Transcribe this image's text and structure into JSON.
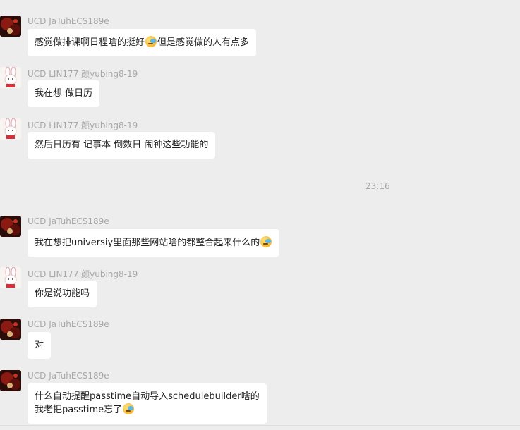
{
  "senders": {
    "a": "UCD JaTuhECS189e",
    "b": "UCD LIN177 颜yubing8-19"
  },
  "messages": [
    {
      "id": 1,
      "sender": "UCD JaTuhECS189e",
      "text_before": "感觉做排课啊日程啥的挺好",
      "text_after": "但是感觉做的人有点多"
    },
    {
      "id": 2,
      "sender": "UCD LIN177 颜yubing8-19",
      "text": "我在想 做日历"
    },
    {
      "id": 3,
      "sender": "UCD LIN177 颜yubing8-19",
      "text": "然后日历有 记事本 倒数日 闹钟这些功能的"
    },
    {
      "id": 4,
      "sender": "UCD JaTuhECS189e",
      "text_before": "我在想把universiy里面那些网站啥的都整合起来什么的",
      "text_after": ""
    },
    {
      "id": 5,
      "sender": "UCD LIN177 颜yubing8-19",
      "text": "你是说功能吗"
    },
    {
      "id": 6,
      "sender": "UCD JaTuhECS189e",
      "text": "对"
    },
    {
      "id": 7,
      "sender": "UCD JaTuhECS189e",
      "line1": "什么自动提醒passtime自动导入schedulebuilder啥的",
      "line2_before": "我老把passtime忘了",
      "line2_after": ""
    }
  ],
  "timestamp": "23:16",
  "icons": {
    "avatar_a": "dark-red-cartoon-avatar",
    "avatar_b": "pink-bunny-avatar",
    "emoji": "laughing-tears-emoji"
  },
  "colors": {
    "background": "#ededed",
    "bubble": "#ffffff",
    "meta_text": "#a7a7a7"
  }
}
